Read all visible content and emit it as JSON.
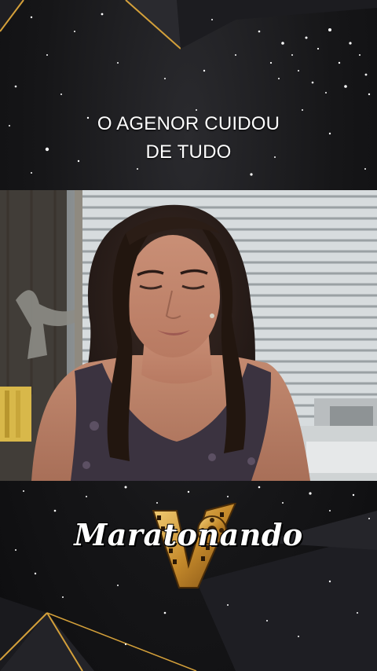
{
  "caption": {
    "line1": "O AGENOR CUIDOU",
    "line2": "DE TUDO"
  },
  "brand": {
    "name": "Maratonando",
    "logo_icon": "film-reel-v-icon"
  },
  "colors": {
    "background": "#161618",
    "gold_accent": "#d4a03a",
    "caption_text": "#ffffff"
  }
}
